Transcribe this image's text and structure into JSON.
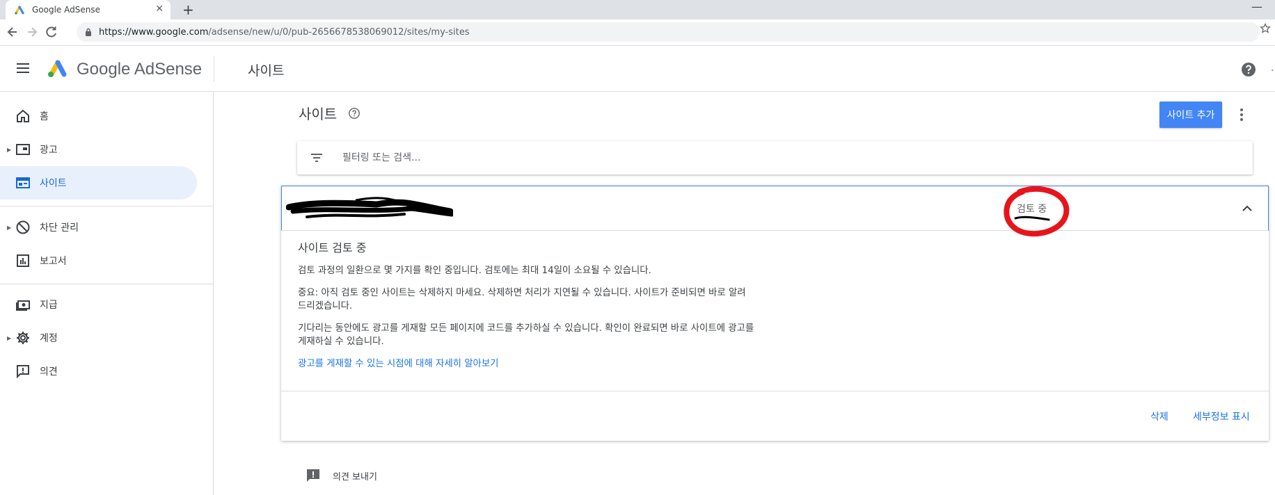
{
  "browser": {
    "tab_title": "Google AdSense",
    "tab_close": "✕",
    "new_tab": "+",
    "minimize": "—",
    "url_host": "https://www.google.com",
    "url_path": "/adsense/new/u/0/pub-2656678538069012/sites/my-sites"
  },
  "header": {
    "brand": "Google AdSense",
    "page_title": "사이트"
  },
  "sidebar": {
    "items": [
      {
        "label": "홈",
        "icon": "home-icon"
      },
      {
        "label": "광고",
        "icon": "ads-icon"
      },
      {
        "label": "사이트",
        "icon": "sites-icon"
      },
      {
        "label": "차단 관리",
        "icon": "block-icon"
      },
      {
        "label": "보고서",
        "icon": "reports-icon"
      },
      {
        "label": "지급",
        "icon": "payments-icon"
      },
      {
        "label": "계정",
        "icon": "gear-icon"
      },
      {
        "label": "의견",
        "icon": "feedback-icon"
      }
    ]
  },
  "main": {
    "title": "사이트",
    "add_site_label": "사이트 추가",
    "filter_placeholder": "필터링 또는 검색...",
    "site": {
      "status": "검토 중",
      "detail_title": "사이트 검토 중",
      "paragraphs": [
        "검토 과정의 일환으로 몇 가지를 확인 중입니다. 검토에는 최대 14일이 소요될 수 있습니다.",
        "중요: 아직 검토 중인 사이트는 삭제하지 마세요. 삭제하면 처리가 지연될 수 있습니다. 사이트가 준비되면 바로 알려 드리겠습니다.",
        "기다리는 동안에도 광고를 게재할 모든 페이지에 코드를 추가하실 수 있습니다. 확인이 완료되면 바로 사이트에 광고를 게재하실 수 있습니다."
      ],
      "learn_more": "광고를 게재할 수 있는 시점에 대해 자세히 알아보기",
      "delete_label": "삭제",
      "details_label": "세부정보 표시"
    },
    "feedback_label": "의견 보내기"
  },
  "colors": {
    "accent": "#4285f4",
    "link": "#1a73e8",
    "active_nav_bg": "#e8f0fe",
    "annotation_red": "#e8141c"
  }
}
